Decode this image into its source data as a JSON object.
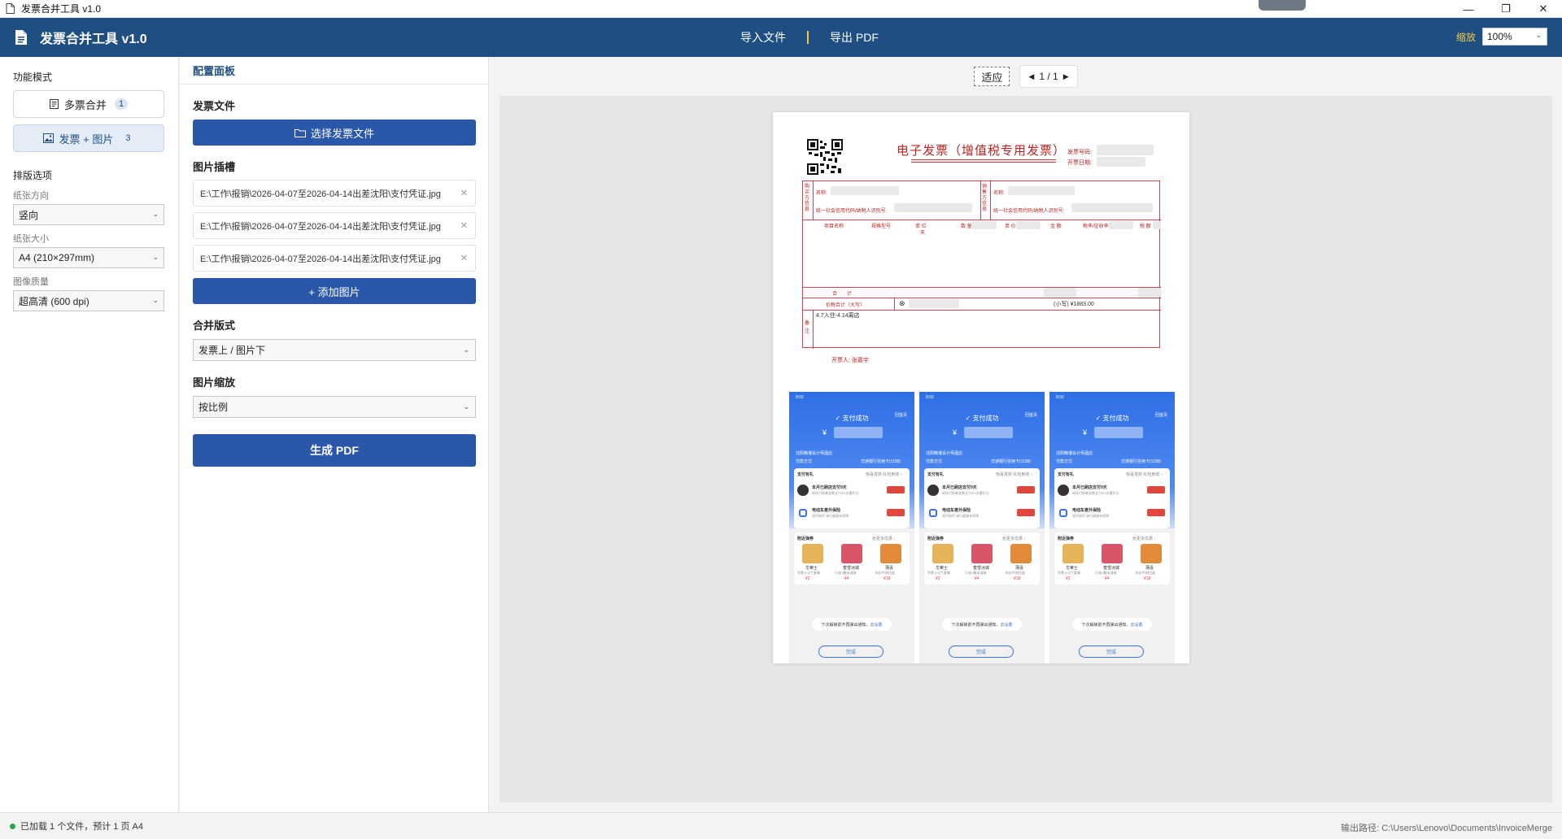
{
  "window": {
    "title": "发票合并工具 v1.0",
    "minimize": "—",
    "restore": "❐",
    "close": "✕"
  },
  "header": {
    "title": "发票合并工具 v1.0",
    "nav": {
      "import": "导入文件",
      "export": "导出 PDF"
    },
    "zoom_label": "缩放",
    "zoom_value": "100%",
    "accent": "#f5c542",
    "bg": "#1f4f82"
  },
  "left": {
    "mode_title": "功能模式",
    "modes": [
      {
        "label": "多票合并",
        "count": "1"
      },
      {
        "label": "发票 + 图片",
        "count": "3",
        "active": true
      }
    ],
    "layout_title": "排版选项",
    "orientation": {
      "label": "纸张方向",
      "value": "竖向"
    },
    "paper": {
      "label": "纸张大小",
      "value": "A4 (210×297mm)"
    },
    "quality": {
      "label": "图像质量",
      "value": "超高清 (600 dpi)"
    }
  },
  "config": {
    "title": "配置面板",
    "invoice_file_label": "发票文件",
    "select_invoice_button": "选择发票文件",
    "image_slots_label": "图片插槽",
    "image_slots": [
      "E:\\工作\\报销\\2026-04-07至2026-04-14出差沈阳\\支付凭证.jpg",
      "E:\\工作\\报销\\2026-04-07至2026-04-14出差沈阳\\支付凭证.jpg",
      "E:\\工作\\报销\\2026-04-07至2026-04-14出差沈阳\\支付凭证.jpg"
    ],
    "add_image_button": "+ 添加图片",
    "merge_layout_label": "合并版式",
    "merge_layout_value": "发票上 / 图片下",
    "image_scale_label": "图片缩放",
    "image_scale_value": "按比例",
    "generate_button": "生成 PDF"
  },
  "preview": {
    "fit_button": "适应",
    "pager": {
      "prev": "◀",
      "page": "1 / 1",
      "next": "▶"
    },
    "invoice": {
      "title": "电子发票（增值税专用发票）",
      "invoice_no_label": "发票号码:",
      "issue_date_label": "开票日期:",
      "buyer_side": "购买方信息",
      "seller_side": "销售方信息",
      "name_label": "名称:",
      "tax_id_label": "统一社会信用代码/纳税人识别号:",
      "columns": [
        "项目名称",
        "规格型号",
        "单 位",
        "数 量",
        "单 价",
        "金 额",
        "税率/征收率",
        "税 额"
      ],
      "unit_value": "天",
      "total_label": "合　　计",
      "total_tax_label": "价税合计（大写）",
      "total_amount": "(小写) ¥1883.00",
      "remarks_side": "备注",
      "remarks": "4.7入住-4.14离店",
      "issuer": "开票人: 张嘉宇"
    },
    "receipt": {
      "status_time": "8:02",
      "home": "回首页",
      "success": "支付成功",
      "yen": "¥",
      "merchant": "沈阳精灌设计师酒店",
      "pay_method": "付款方式",
      "pay_card": "交通银行信用卡(1158)",
      "gift": "支付有礼",
      "gift_right": "惊喜发财 红包到账 ›",
      "promo1_title": "本月已刷店支付9天",
      "promo1_sub": "继续付款最频繁支付9%多赢积分",
      "promo1_btn": "看优惠",
      "promo2_title": "电动车意外保险",
      "promo2_sub": "限时福利 骑行健康有保障",
      "promo2_btn": "去看看",
      "nearby": "附近弹券",
      "nearby_right": "抢更多优惠 ›",
      "items": [
        "华莱士",
        "蜜雪冰城",
        "蒲喜"
      ],
      "item_subs": [
        "华莱士元气套餐",
        "只选1桶冰淇淋",
        "折扣牛肉拉面"
      ],
      "item_prices": [
        "¥2",
        "¥4",
        "¥18"
      ],
      "bubble": "下次解锁前不再弹出通知，",
      "bubble_link": "去设置",
      "done": "完成"
    }
  },
  "status": {
    "left": "已加载 1 个文件，预计 1 页 A4",
    "right_label": "输出路径:",
    "right_path": "C:\\Users\\Lenovo\\Documents\\InvoiceMerge"
  }
}
